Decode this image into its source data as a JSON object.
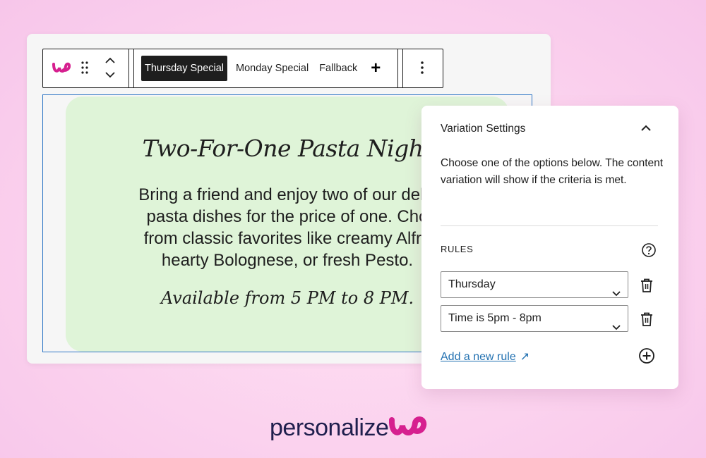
{
  "toolbar": {
    "tabs": [
      {
        "label": "Thursday Special",
        "active": true
      },
      {
        "label": "Monday Special",
        "active": false
      },
      {
        "label": "Fallback",
        "active": false
      }
    ],
    "add_label": "+"
  },
  "content": {
    "headline": "Two-For-One Pasta Night",
    "body": "Bring a friend and enjoy two of our delic\npasta dishes for the price of one. Cho\nfrom classic favorites like creamy Alfre\nhearty Bolognese, or fresh Pesto.",
    "availability": "Available from 5 PM to 8 PM."
  },
  "panel": {
    "title": "Variation Settings",
    "description": "Choose one of the options below. The content variation will show if the criteria is met.",
    "rules_label": "RULES",
    "rules": [
      {
        "value": "Thursday"
      },
      {
        "value": "Time is 5pm - 8pm"
      }
    ],
    "add_rule_label": "Add a new rule",
    "add_rule_arrow": "↗"
  },
  "brand": {
    "name": "personalize"
  },
  "colors": {
    "brand_magenta": "#d6208f",
    "block_border": "#2f76c6",
    "content_bg": "#dff4d8",
    "link": "#2271b1"
  }
}
